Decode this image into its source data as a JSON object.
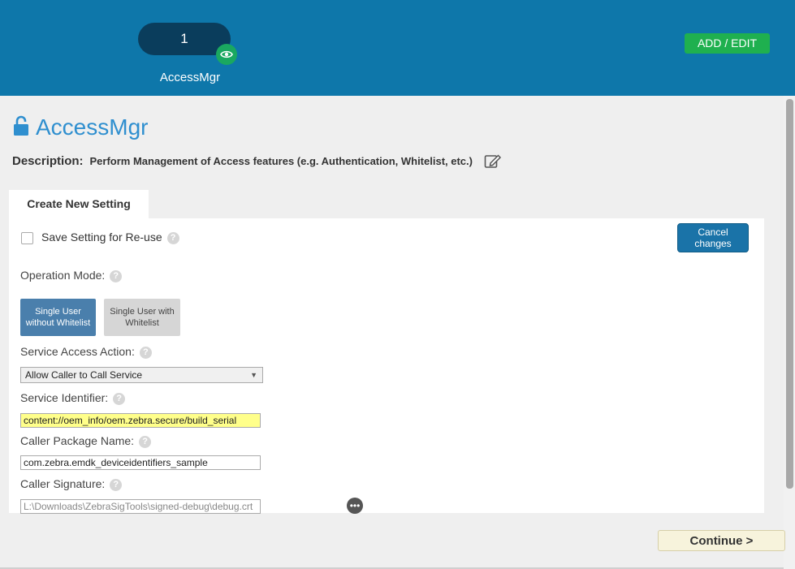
{
  "header": {
    "step_number": "1",
    "step_label": "AccessMgr",
    "add_edit_label": "ADD / EDIT"
  },
  "page": {
    "title": "AccessMgr",
    "description_label": "Description:",
    "description_text": "Perform Management of Access features (e.g. Authentication, Whitelist, etc.)"
  },
  "tabs": [
    {
      "label": "Create New Setting"
    }
  ],
  "form": {
    "reuse_label": "Save Setting for Re-use",
    "cancel_label": "Cancel changes",
    "operation_mode_label": "Operation Mode:",
    "mode_options": [
      "Single User without Whitelist",
      "Single User with Whitelist"
    ],
    "selected_mode": "Single User without Whitelist",
    "service_access_action_label": "Service Access Action:",
    "service_access_action_value": "Allow Caller to Call Service",
    "service_identifier_label": "Service Identifier:",
    "service_identifier_value": "content://oem_info/oem.zebra.secure/build_serial",
    "caller_package_label": "Caller Package Name:",
    "caller_package_value": "com.zebra.emdk_deviceidentifiers_sample",
    "caller_signature_label": "Caller Signature:",
    "caller_signature_value": "L:\\Downloads\\ZebraSigTools\\signed-debug\\debug.crt",
    "help_glyph": "?",
    "more_glyph": "•••"
  },
  "footer": {
    "continue_label": "Continue  >"
  },
  "colors": {
    "header_bg": "#0e77aa",
    "accent_green": "#1fb04f",
    "title_blue": "#2f8fcf",
    "selected_mode": "#4a7fac",
    "highlight_input": "#ffff8a"
  },
  "icons": {
    "visibility": "eye-icon",
    "lock": "unlock-icon",
    "edit": "edit-icon",
    "dropdown": "chevron-down-icon",
    "browse": "ellipsis-icon"
  }
}
